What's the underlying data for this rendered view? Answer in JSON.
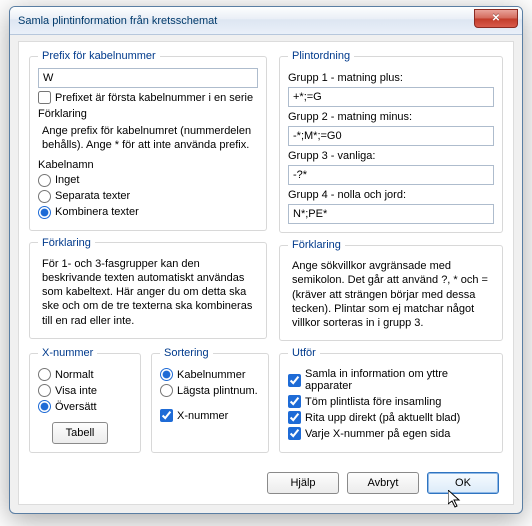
{
  "window": {
    "title": "Samla plintinformation från kretsschemat"
  },
  "prefix": {
    "legend": "Prefix för kabelnummer",
    "value": "W",
    "checkbox_label": "Prefixet är första kabelnummer i en serie",
    "checkbox_checked": false,
    "explain_heading": "Förklaring",
    "explain_text": "Ange prefix för kabelnumret (nummerdelen behålls). Ange * för att inte använda prefix.",
    "kabelnamn_heading": "Kabelnamn",
    "radios": {
      "inget": "Inget",
      "separata": "Separata texter",
      "kombinera": "Kombinera texter",
      "selected": "kombinera"
    }
  },
  "left_explain": {
    "legend": "Förklaring",
    "text": "För 1- och 3-fasgrupper kan den beskrivande texten automatiskt användas som kabeltext. Här anger du om detta ska ske och om de tre texterna ska kombineras till en rad eller inte."
  },
  "order": {
    "legend": "Plintordning",
    "g1_label": "Grupp 1 - matning plus:",
    "g1_value": "+*;=G",
    "g2_label": "Grupp 2 - matning minus:",
    "g2_value": "-*;M*;=G0",
    "g3_label": "Grupp 3 - vanliga:",
    "g3_value": "-?*",
    "g4_label": "Grupp 4 - nolla och jord:",
    "g4_value": "N*;PE*"
  },
  "right_explain": {
    "legend": "Förklaring",
    "text": "Ange sökvillkor avgränsade med semikolon. Det går att använd ?,  * och = (kräver att strängen börjar med dessa tecken). Plintar som ej matchar något villkor sorteras in i grupp 3."
  },
  "xnum": {
    "legend": "X-nummer",
    "normalt": "Normalt",
    "visa_inte": "Visa inte",
    "oversatt": "Översätt",
    "selected": "oversatt",
    "table_btn": "Tabell"
  },
  "sort": {
    "legend": "Sortering",
    "kabel": "Kabelnummer",
    "lagsta": "Lägsta plintnum.",
    "selected": "kabel",
    "xnum_label": "X-nummer",
    "xnum_checked": true
  },
  "utfor": {
    "legend": "Utför",
    "o1": "Samla in information om yttre apparater",
    "o2": "Töm plintlista före insamling",
    "o3": "Rita upp direkt (på aktuellt blad)",
    "o4": "Varje X-nummer på egen sida",
    "c1": true,
    "c2": true,
    "c3": true,
    "c4": true
  },
  "buttons": {
    "help": "Hjälp",
    "cancel": "Avbryt",
    "ok": "OK"
  }
}
